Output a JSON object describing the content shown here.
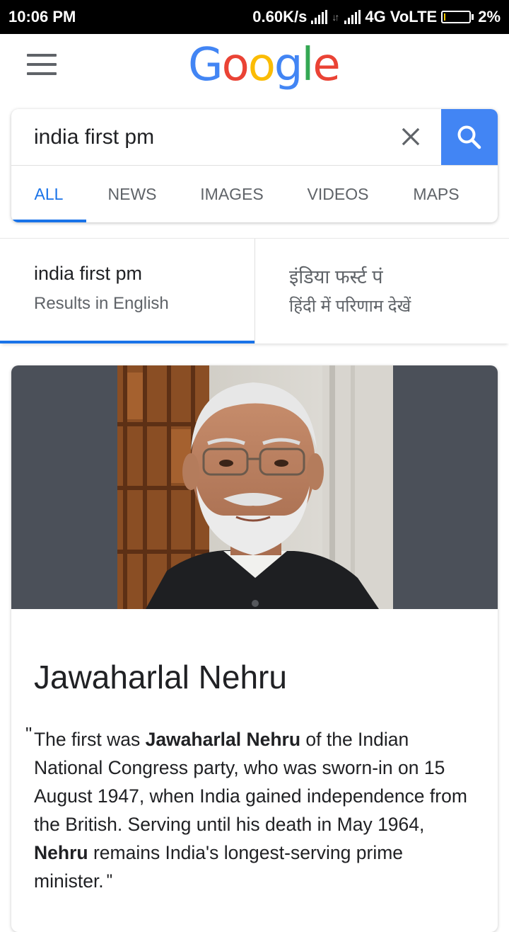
{
  "status_bar": {
    "time": "10:06 PM",
    "speed": "0.60K/s",
    "network": "4G VoLTE",
    "battery": "2%"
  },
  "header": {
    "logo_letters": [
      "G",
      "o",
      "o",
      "g",
      "l",
      "e"
    ]
  },
  "search": {
    "query": "india first pm"
  },
  "tabs": [
    {
      "label": "ALL",
      "active": true
    },
    {
      "label": "NEWS",
      "active": false
    },
    {
      "label": "IMAGES",
      "active": false
    },
    {
      "label": "VIDEOS",
      "active": false
    },
    {
      "label": "MAPS",
      "active": false
    }
  ],
  "language": {
    "english_title": "india first pm",
    "english_sub": "Results in English",
    "hindi_title": "इंडिया फर्स्ट पं",
    "hindi_sub": "हिंदी में परिणाम देखें"
  },
  "result": {
    "name": "Jawaharlal Nehru",
    "quote_open": "\"",
    "quote_close": "\"",
    "quote_part1": "The first was ",
    "quote_bold1": "Jawaharlal Nehru",
    "quote_part2": " of the Indian National Congress party, who was sworn-in on 15 August 1947, when India gained independence from the British. Serving until his death in May 1964, ",
    "quote_bold2": "Nehru",
    "quote_part3": " remains India's longest-serving prime minister."
  },
  "colors": {
    "accent_blue": "#1a73e8",
    "search_button": "#4285f4",
    "portrait_band": "#4b5059"
  }
}
